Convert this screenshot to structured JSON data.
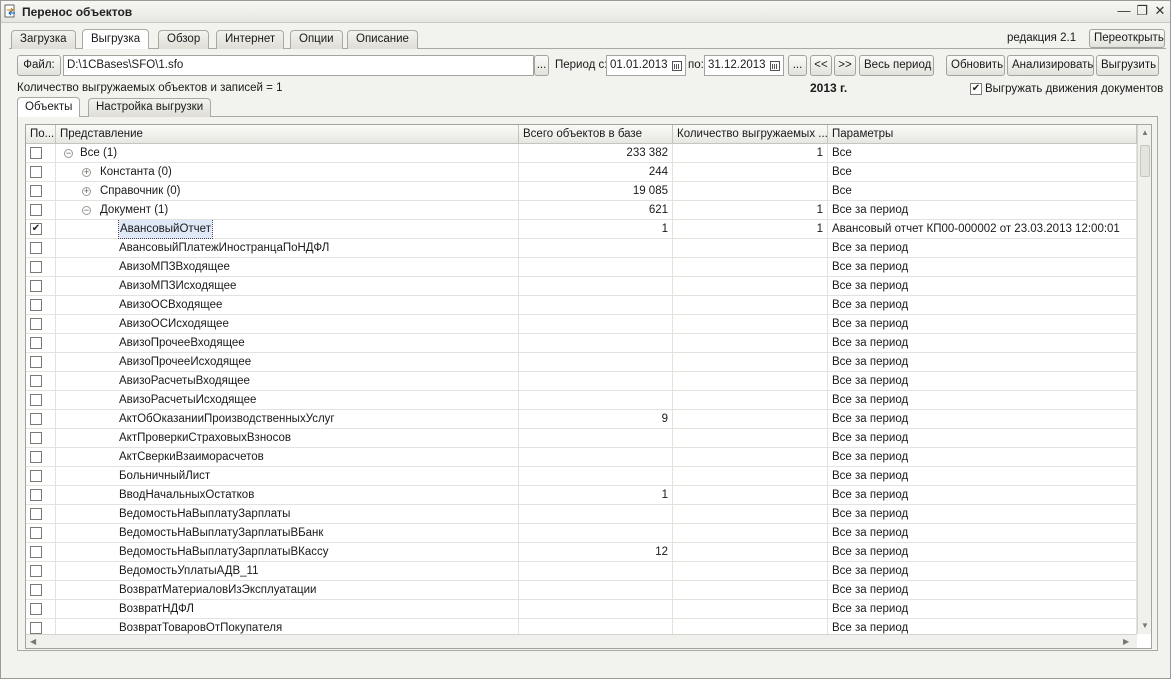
{
  "window": {
    "title": "Перенос объектов",
    "buttons": {
      "minimize": "—",
      "restore": "❐",
      "close": "✕"
    }
  },
  "tabs": [
    "Загрузка",
    "Выгрузка",
    "Обзор",
    "Интернет",
    "Опции",
    "Описание"
  ],
  "active_tab": "Выгрузка",
  "edition": "редакция 2.1",
  "reopen_button": "Переоткрыть",
  "toolbar": {
    "file_button": "Файл:",
    "file_path": "D:\\1CBases\\SFO\\1.sfo",
    "file_browse": "...",
    "period_from_label": "Период с:",
    "period_from": "01.01.2013",
    "period_to_label": "по:",
    "period_to": "31.12.2013",
    "period_select": "...",
    "prev": "<<",
    "next": ">>",
    "whole_period": "Весь период",
    "refresh": "Обновить",
    "analyze": "Анализировать",
    "export": "Выгрузить"
  },
  "count_text": "Количество выгружаемых объектов и записей = 1",
  "year_label": "2013 г.",
  "export_movements": {
    "label": "Выгружать движения документов",
    "checked": true
  },
  "subtabs": [
    "Объекты",
    "Настройка выгрузки"
  ],
  "active_subtab": "Объекты",
  "grid": {
    "columns": [
      "По...",
      "Представление",
      "Всего объектов в базе",
      "Количество выгружаемых ...",
      "Параметры"
    ],
    "rows": [
      {
        "checked": false,
        "level": 0,
        "expand": "minus",
        "name": "Все (1)",
        "total": "233 382",
        "export": "1",
        "params": "Все"
      },
      {
        "checked": false,
        "level": 1,
        "expand": "plus",
        "name": "Константа (0)",
        "total": "244",
        "export": "",
        "params": "Все"
      },
      {
        "checked": false,
        "level": 1,
        "expand": "plus",
        "name": "Справочник (0)",
        "total": "19 085",
        "export": "",
        "params": "Все"
      },
      {
        "checked": false,
        "level": 1,
        "expand": "minus",
        "name": "Документ (1)",
        "total": "621",
        "export": "1",
        "params": "Все за период"
      },
      {
        "checked": true,
        "level": 2,
        "expand": "",
        "name": "АвансовыйОтчет",
        "total": "1",
        "export": "1",
        "params": "Авансовый отчет КП00-000002 от 23.03.2013 12:00:01",
        "selected": true
      },
      {
        "checked": false,
        "level": 2,
        "expand": "",
        "name": "АвансовыйПлатежИностранцаПоНДФЛ",
        "total": "",
        "export": "",
        "params": "Все за период"
      },
      {
        "checked": false,
        "level": 2,
        "expand": "",
        "name": "АвизоМПЗВходящее",
        "total": "",
        "export": "",
        "params": "Все за период"
      },
      {
        "checked": false,
        "level": 2,
        "expand": "",
        "name": "АвизоМПЗИсходящее",
        "total": "",
        "export": "",
        "params": "Все за период"
      },
      {
        "checked": false,
        "level": 2,
        "expand": "",
        "name": "АвизоОСВходящее",
        "total": "",
        "export": "",
        "params": "Все за период"
      },
      {
        "checked": false,
        "level": 2,
        "expand": "",
        "name": "АвизоОСИсходящее",
        "total": "",
        "export": "",
        "params": "Все за период"
      },
      {
        "checked": false,
        "level": 2,
        "expand": "",
        "name": "АвизоПрочееВходящее",
        "total": "",
        "export": "",
        "params": "Все за период"
      },
      {
        "checked": false,
        "level": 2,
        "expand": "",
        "name": "АвизоПрочееИсходящее",
        "total": "",
        "export": "",
        "params": "Все за период"
      },
      {
        "checked": false,
        "level": 2,
        "expand": "",
        "name": "АвизоРасчетыВходящее",
        "total": "",
        "export": "",
        "params": "Все за период"
      },
      {
        "checked": false,
        "level": 2,
        "expand": "",
        "name": "АвизоРасчетыИсходящее",
        "total": "",
        "export": "",
        "params": "Все за период"
      },
      {
        "checked": false,
        "level": 2,
        "expand": "",
        "name": "АктОбОказанииПроизводственныхУслуг",
        "total": "9",
        "export": "",
        "params": "Все за период"
      },
      {
        "checked": false,
        "level": 2,
        "expand": "",
        "name": "АктПроверкиСтраховыхВзносов",
        "total": "",
        "export": "",
        "params": "Все за период"
      },
      {
        "checked": false,
        "level": 2,
        "expand": "",
        "name": "АктСверкиВзаиморасчетов",
        "total": "",
        "export": "",
        "params": "Все за период"
      },
      {
        "checked": false,
        "level": 2,
        "expand": "",
        "name": "БольничныйЛист",
        "total": "",
        "export": "",
        "params": "Все за период"
      },
      {
        "checked": false,
        "level": 2,
        "expand": "",
        "name": "ВводНачальныхОстатков",
        "total": "1",
        "export": "",
        "params": "Все за период"
      },
      {
        "checked": false,
        "level": 2,
        "expand": "",
        "name": "ВедомостьНаВыплатуЗарплаты",
        "total": "",
        "export": "",
        "params": "Все за период"
      },
      {
        "checked": false,
        "level": 2,
        "expand": "",
        "name": "ВедомостьНаВыплатуЗарплатыВБанк",
        "total": "",
        "export": "",
        "params": "Все за период"
      },
      {
        "checked": false,
        "level": 2,
        "expand": "",
        "name": "ВедомостьНаВыплатуЗарплатыВКассу",
        "total": "12",
        "export": "",
        "params": "Все за период"
      },
      {
        "checked": false,
        "level": 2,
        "expand": "",
        "name": "ВедомостьУплатыАДВ_11",
        "total": "",
        "export": "",
        "params": "Все за период"
      },
      {
        "checked": false,
        "level": 2,
        "expand": "",
        "name": "ВозвратМатериаловИзЭксплуатации",
        "total": "",
        "export": "",
        "params": "Все за период"
      },
      {
        "checked": false,
        "level": 2,
        "expand": "",
        "name": "ВозвратНДФЛ",
        "total": "",
        "export": "",
        "params": "Все за период"
      },
      {
        "checked": false,
        "level": 2,
        "expand": "",
        "name": "ВозвратТоваровОтПокупателя",
        "total": "",
        "export": "",
        "params": "Все за период"
      }
    ]
  }
}
